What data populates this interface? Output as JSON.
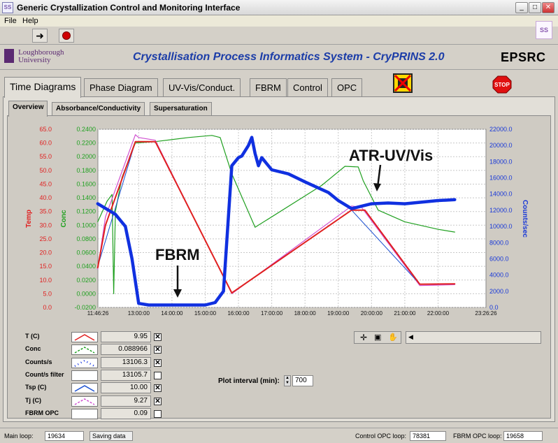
{
  "window": {
    "title": "Generic Crystallization Control and Monitoring Interface",
    "app_icon_text": "SS"
  },
  "menu": {
    "file": "File",
    "help": "Help"
  },
  "header": {
    "logo_line1": "Loughborough",
    "logo_line2": "University",
    "app_title": "Crystallisation Process Informatics System - CryPRINS 2.0",
    "sponsor": "EPSRC"
  },
  "tabs": {
    "main": [
      "Time Diagrams",
      "Phase Diagram",
      "UV-Vis/Conduct.",
      "FBRM",
      "Control",
      "OPC"
    ],
    "active_main": "Time Diagrams",
    "sub": [
      "Overview",
      "Absorbance/Conductivity",
      "Supersaturation"
    ],
    "active_sub": "Overview"
  },
  "stop_label": "STOP",
  "plot_interval": {
    "label": "Plot interval (min):",
    "value": "700"
  },
  "legend": [
    {
      "name": "T (C)",
      "value": "9.95",
      "checked": true,
      "color": "#e02020"
    },
    {
      "name": "Conc",
      "value": "0.088966",
      "checked": true,
      "color": "#20a020"
    },
    {
      "name": "Counts/s",
      "value": "13106.3",
      "checked": true,
      "color": "#1030e0"
    },
    {
      "name": "Count/s filter",
      "value": "13105.7",
      "checked": false,
      "color": "#ffffff"
    },
    {
      "name": "Tsp (C)",
      "value": "10.00",
      "checked": true,
      "color": "#1a4fd0"
    },
    {
      "name": "Tj (C)",
      "value": "9.27",
      "checked": true,
      "color": "#d050d0"
    },
    {
      "name": "FBRM OPC",
      "value": "0.09",
      "checked": false,
      "color": "#ffffff"
    }
  ],
  "status": {
    "main_loop_label": "Main loop:",
    "main_loop": "19634",
    "saving": "Saving data",
    "control_opc_label": "Control OPC loop:",
    "control_opc": "78381",
    "fbrm_opc_label": "FBRM OPC loop:",
    "fbrm_opc": "19658"
  },
  "chart_data": {
    "type": "line",
    "x_ticks": [
      "11:46:26",
      "13:00:00",
      "14:00:00",
      "15:00:00",
      "16:00:00",
      "17:00:00",
      "18:00:00",
      "19:00:00",
      "20:00:00",
      "21:00:00",
      "22:00:00",
      "23:26:26"
    ],
    "y_left_temp": {
      "label": "Temp",
      "color": "#e02020",
      "ticks": [
        "65.0",
        "60.0",
        "55.0",
        "50.0",
        "45.0",
        "40.0",
        "35.0",
        "30.0",
        "25.0",
        "20.0",
        "15.0",
        "10.0",
        "5.0",
        "0.0"
      ],
      "range": [
        0,
        65
      ]
    },
    "y_left_conc": {
      "label": "Conc",
      "color": "#20a020",
      "ticks": [
        "0.2400",
        "0.2200",
        "0.2000",
        "0.1800",
        "0.1600",
        "0.1400",
        "0.1200",
        "0.1000",
        "0.0800",
        "0.0600",
        "0.0400",
        "0.0200",
        "0.0000",
        "-0.0200"
      ],
      "range": [
        -0.02,
        0.24
      ]
    },
    "y_right": {
      "label": "Counts/sec",
      "color": "#1a3ad8",
      "ticks": [
        "22000.0",
        "20000.0",
        "18000.0",
        "16000.0",
        "14000.0",
        "12000.0",
        "10000.0",
        "8000.0",
        "6000.0",
        "4000.0",
        "2000.0",
        "0.0"
      ],
      "range": [
        0,
        22000
      ]
    },
    "annotations": [
      "FBRM",
      "ATR-UV/Vis"
    ],
    "series": [
      {
        "name": "T (C)",
        "axis": "temp",
        "color": "#e02020",
        "x": [
          11.77,
          12.0,
          12.9,
          13.5,
          15.8,
          19.4,
          19.8,
          21.45,
          22.5
        ],
        "y": [
          14.5,
          30.0,
          60.5,
          60.5,
          5.3,
          35.5,
          35.5,
          8.5,
          8.6
        ]
      },
      {
        "name": "Tj (C)",
        "axis": "temp",
        "color": "#d050d0",
        "x": [
          11.77,
          12.0,
          12.9,
          13.0,
          13.5,
          15.8,
          19.4,
          19.7,
          21.45,
          22.5
        ],
        "y": [
          14.0,
          33.0,
          63.0,
          62.0,
          61.0,
          5.0,
          37.0,
          36.5,
          8.0,
          8.3
        ]
      },
      {
        "name": "Conc",
        "axis": "conc",
        "color": "#20a020",
        "x": [
          11.77,
          12.05,
          12.2,
          12.25,
          12.3,
          12.5,
          12.9,
          13.5,
          14.5,
          15.2,
          15.45,
          15.8,
          16.5,
          18.5,
          19.2,
          19.6,
          19.75,
          20.2,
          21.0,
          22.0,
          22.5
        ],
        "y": [
          0.105,
          0.135,
          0.145,
          0.0,
          0.12,
          0.17,
          0.22,
          0.222,
          0.228,
          0.231,
          0.228,
          0.175,
          0.097,
          0.158,
          0.186,
          0.185,
          0.165,
          0.122,
          0.105,
          0.094,
          0.09
        ]
      },
      {
        "name": "Counts/s",
        "axis": "counts",
        "color": "#1030e0",
        "x": [
          11.77,
          12.3,
          12.6,
          12.8,
          13.0,
          13.3,
          15.0,
          15.3,
          15.55,
          15.8,
          16.0,
          16.1,
          16.3,
          16.4,
          16.5,
          16.6,
          16.7,
          17.0,
          17.5,
          18.0,
          18.7,
          19.0,
          19.4,
          19.7,
          20.0,
          20.5,
          21.0,
          22.0,
          22.5
        ],
        "y": [
          12800,
          11500,
          10000,
          6000,
          500,
          300,
          300,
          600,
          2000,
          17500,
          18500,
          18700,
          20000,
          21000,
          19000,
          17500,
          18500,
          17000,
          16500,
          15500,
          14200,
          13200,
          12200,
          12500,
          12800,
          12900,
          12800,
          13200,
          13300
        ]
      },
      {
        "name": "Tsp (C)",
        "axis": "temp",
        "color": "#1a4fd0",
        "x": [
          11.77,
          12.9,
          13.5,
          15.8,
          19.4,
          21.45,
          22.5
        ],
        "y": [
          15.0,
          60.5,
          60.5,
          5.3,
          35.5,
          8.5,
          8.6
        ]
      }
    ]
  }
}
